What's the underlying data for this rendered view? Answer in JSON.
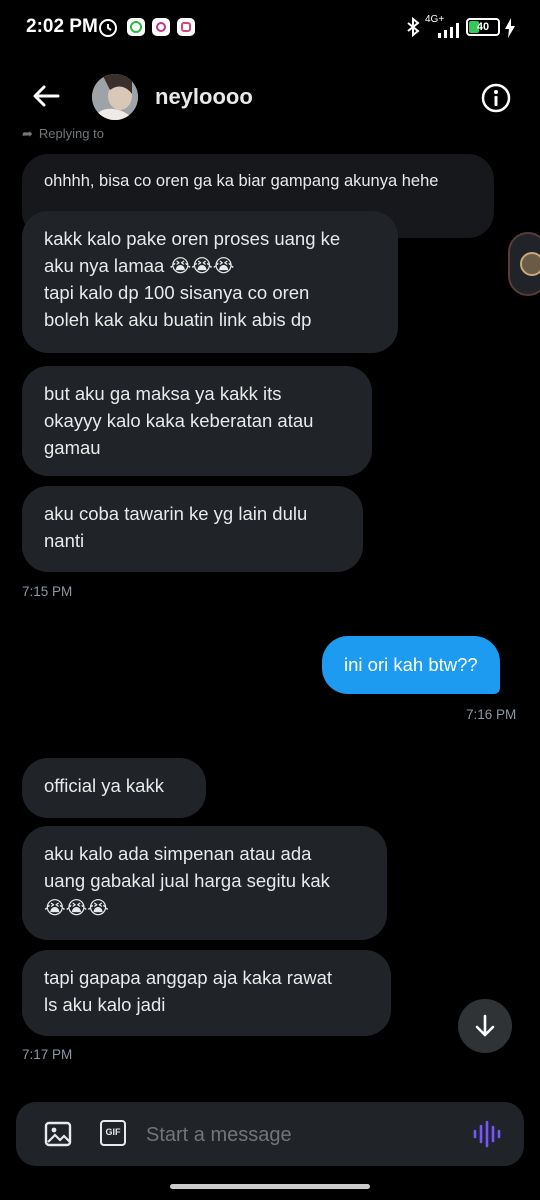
{
  "status_bar": {
    "time": "2:02 PM",
    "battery": "40",
    "network": "4G+"
  },
  "header": {
    "username": "neyloooo"
  },
  "reply_context": {
    "label": "Replying to",
    "quoted_text": "ohhhh, bisa co oren ga ka biar gampang akunya hehe"
  },
  "messages": [
    {
      "text": "kakk kalo pake oren proses uang ke\naku nya lamaa 😭😭😭\ntapi kalo dp 100 sisanya co oren\nboleh kak aku buatin link abis dp"
    },
    {
      "text": "but aku ga maksa ya kakk its\nokayyy kalo kaka keberatan atau\ngamau"
    },
    {
      "text": "aku coba tawarin ke yg lain dulu\nnanti"
    },
    {
      "text": "ini ori kah btw??"
    },
    {
      "text": "official ya kakk"
    },
    {
      "text": "aku kalo ada simpenan atau ada\nuang gabakal jual harga segitu kak\n😭😭😭"
    },
    {
      "text": "tapi gapapa anggap aja kaka rawat\nls aku kalo jadi"
    }
  ],
  "timestamps": {
    "t1": "7:15 PM",
    "t2": "7:16 PM",
    "t3": "7:17 PM"
  },
  "composer": {
    "placeholder": "Start a message",
    "gif_label": "GIF"
  },
  "colors": {
    "accent": "#1d9bf0",
    "bubble": "#202327",
    "background": "#000000",
    "voice": "#7856ff"
  }
}
